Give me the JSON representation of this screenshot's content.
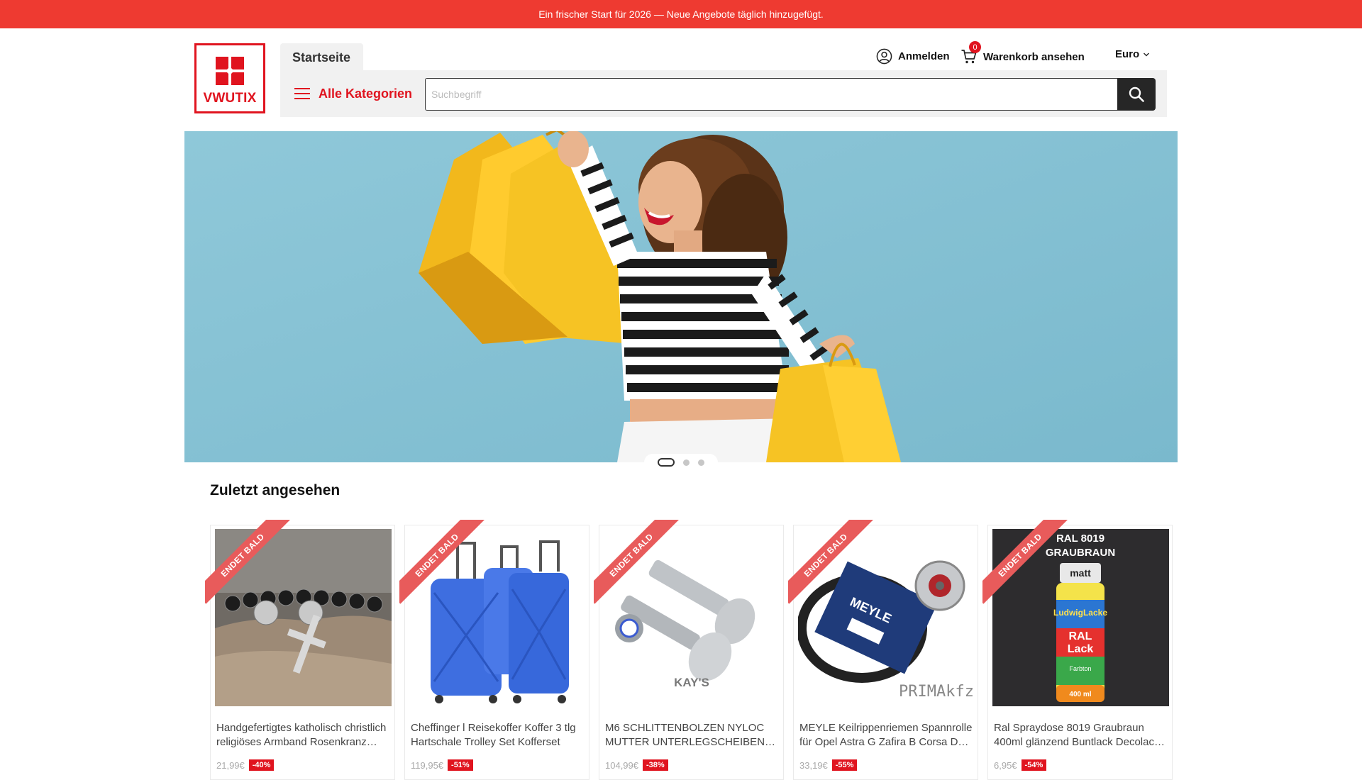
{
  "announcement": "Ein frischer Start für 2026 — Neue Angebote täglich hinzugefügt.",
  "logo": {
    "text": "VWUTIX"
  },
  "nav": {
    "home_tab": "Startseite",
    "categories_label": "Alle Kategorien"
  },
  "search": {
    "placeholder": "Suchbegriff",
    "value": ""
  },
  "account": {
    "login_label": "Anmelden",
    "cart_label": "Warenkorb ansehen",
    "cart_count": "0",
    "currency": "Euro"
  },
  "colors": {
    "brand_red": "#e0141f",
    "top_banner": "#ee3a31",
    "hero_bg": "#88c3d5"
  },
  "hero": {
    "slide_count": 3,
    "active_slide": 1
  },
  "recently_viewed": {
    "title": "Zuletzt angesehen",
    "products": [
      {
        "ribbon": "ENDET BALD",
        "title": "Handgefertigtes katholisch christlich religiöses Armband Rosenkranz…",
        "old_price": "21,99€",
        "discount": "-40%"
      },
      {
        "ribbon": "ENDET BALD",
        "title": "Cheffinger l Reisekoffer Koffer 3 tlg Hartschale Trolley Set Kofferset",
        "old_price": "119,95€",
        "discount": "-51%"
      },
      {
        "ribbon": "ENDET BALD",
        "title": "M6 SCHLITTENBOLZEN NYLOC MUTTER UNTERLEGSCHEIBEN…",
        "old_price": "104,99€",
        "discount": "-38%"
      },
      {
        "ribbon": "ENDET BALD",
        "title": "MEYLE Keilrippenriemen Spannrolle für Opel Astra G Zafira B Corsa D…",
        "old_price": "33,19€",
        "discount": "-55%"
      },
      {
        "ribbon": "ENDET BALD",
        "title": "Ral Spraydose 8019 Graubraun 400ml glänzend Buntlack Decolac…",
        "old_price": "6,95€",
        "discount": "-54%"
      }
    ]
  },
  "product_images": {
    "kays_label": "KAY'S",
    "meyle_label": "MEYLE",
    "prima_label": "PRIMAkfz",
    "spray_heading_1": "RAL 8019",
    "spray_heading_2": "GRAUBRAUN",
    "spray_matt": "matt",
    "spray_brand": "LudwigLacke",
    "spray_ral": "RAL",
    "spray_lack": "Lack",
    "spray_farbton": "Farbton",
    "spray_ml": "400 ml"
  }
}
